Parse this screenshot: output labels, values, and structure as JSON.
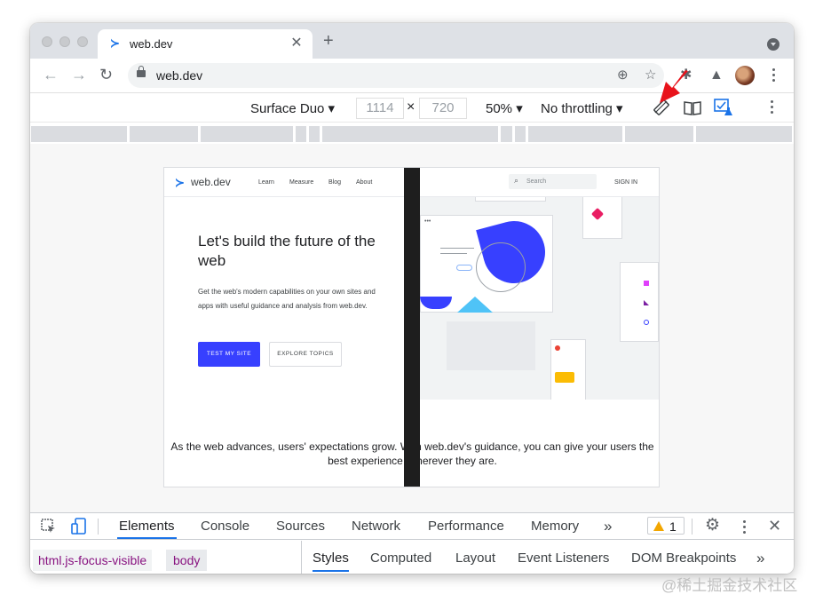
{
  "browser": {
    "tab": {
      "title": "web.dev"
    },
    "address_bar": {
      "url": "web.dev"
    }
  },
  "device_toolbar": {
    "device": "Surface Duo",
    "width": "1114",
    "height": "720",
    "times": "×",
    "zoom": "50%",
    "throttling": "No throttling"
  },
  "site": {
    "logo": "web.dev",
    "nav": [
      "Learn",
      "Measure",
      "Blog",
      "About"
    ],
    "search_placeholder": "Search",
    "sign_in": "SIGN IN",
    "hero_title": "Let's build the future of the web",
    "hero_description": "Get the web's modern capabilities on your own sites and apps with useful guidance and analysis from web.dev.",
    "primary_button": "TEST MY SITE",
    "secondary_button": "EXPLORE TOPICS",
    "tagline": "As the web advances, users' expectations grow. With web.dev's guidance, you can give your users the best experience, wherever they are."
  },
  "devtools": {
    "tabs": [
      "Elements",
      "Console",
      "Sources",
      "Network",
      "Performance",
      "Memory"
    ],
    "more": "»",
    "warning_count": "1",
    "breadcrumbs": [
      "html.js-focus-visible",
      "body"
    ],
    "subtabs": [
      "Styles",
      "Computed",
      "Layout",
      "Event Listeners",
      "DOM Breakpoints"
    ]
  },
  "watermark": "@稀土掘金技术社区",
  "colors": {
    "accent": "#1a73e8",
    "primary_button": "#3740ff",
    "annotation_arrow": "#e8131b",
    "warning": "#f2a600"
  }
}
